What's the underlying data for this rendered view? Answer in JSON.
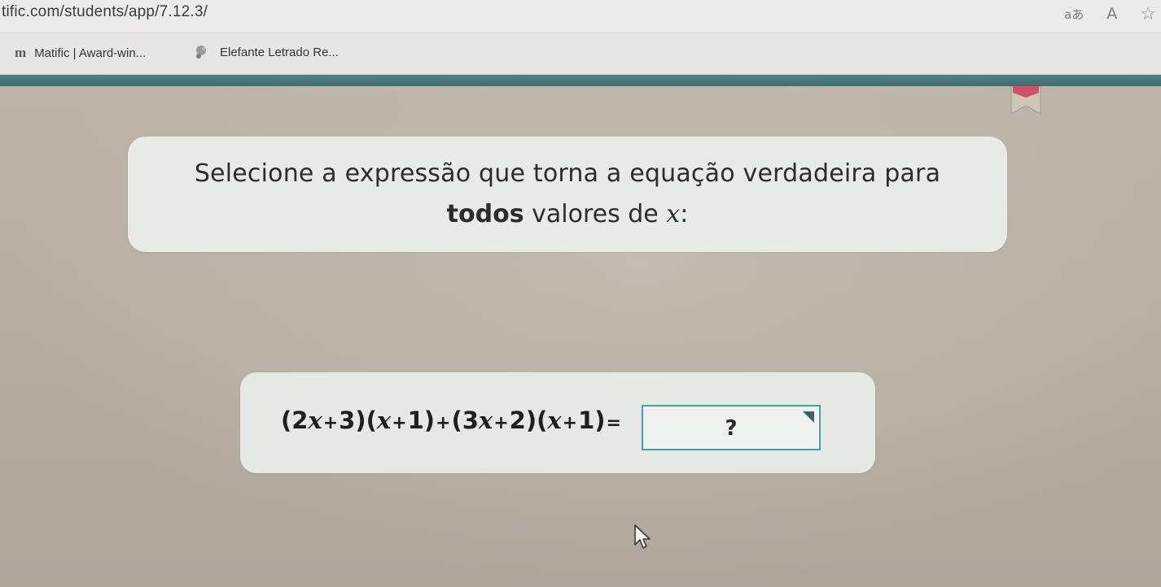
{
  "browser": {
    "url": "tific.com/students/app/7.12.3/",
    "toolbar_icons": [
      "reader-mode-icon",
      "read-aloud-icon",
      "favorite-star-icon"
    ],
    "reader_label": "aあ",
    "read_aloud_label": "A"
  },
  "bookmarks": [
    {
      "icon": "matific-logo-icon",
      "icon_text": "m",
      "label": "Matific | Award-win..."
    },
    {
      "icon": "elefante-logo-icon",
      "label": "Elefante Letrado Re..."
    }
  ],
  "question": {
    "line1": "Selecione a expressão que torna a equação verdadeira para",
    "line2_bold": "todos",
    "line2_rest": " valores de ",
    "line2_var": "x",
    "line2_end": ":"
  },
  "equation": {
    "parts": [
      {
        "t": "(2"
      },
      {
        "v": "x"
      },
      {
        "o": "+"
      },
      {
        "t": "3)("
      },
      {
        "v": "x"
      },
      {
        "o": "+"
      },
      {
        "t": "1)"
      },
      {
        "o": "+"
      },
      {
        "t": "(3"
      },
      {
        "v": "x"
      },
      {
        "o": "+"
      },
      {
        "t": "2)("
      },
      {
        "v": "x"
      },
      {
        "o": "+"
      },
      {
        "t": "1)"
      },
      {
        "o": "="
      }
    ],
    "answer_placeholder": "?"
  },
  "colors": {
    "teal_bar": "#4f8386",
    "answer_border": "#4d9ea0",
    "card_bg": "#e8eae6",
    "app_bg": "#b8b0a4"
  }
}
